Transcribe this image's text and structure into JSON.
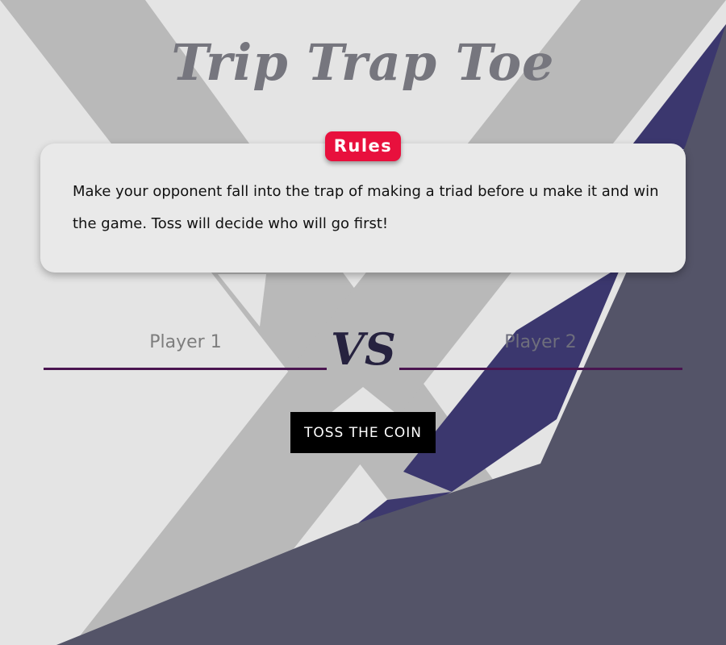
{
  "title": "Trip Trap Toe",
  "rules": {
    "badge_label": "Rules",
    "text": "Make your opponent fall into the trap of making a triad before u make it and win the game. Toss will decide who will go first!"
  },
  "players": {
    "player1_label": "Player 1",
    "vs_label": "VS",
    "player2_label": "Player 2"
  },
  "toss_button_label": "TOSS THE COIN",
  "colors": {
    "background": "#e4e4e4",
    "x_shape": "#b9b9b9",
    "dark_slate": "#545468",
    "indigo": "#3b376e",
    "rules_badge": "#e8103d",
    "title": "#76767e",
    "player_line": "#4a1550",
    "button": "#000000"
  }
}
